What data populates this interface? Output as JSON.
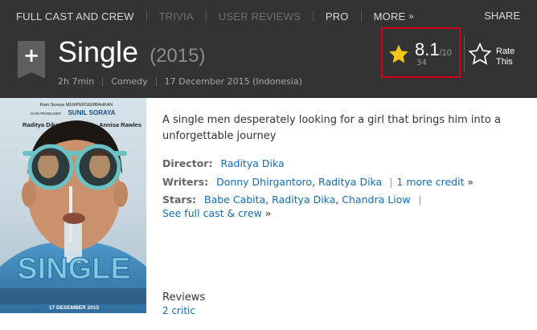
{
  "nav": {
    "full_cast": "FULL CAST AND CREW",
    "trivia": "TRIVIA",
    "user_reviews": "USER REVIEWS",
    "pro": "PRO",
    "more": "MORE",
    "share": "SHARE"
  },
  "movie": {
    "title": "Single",
    "year": "(2015)",
    "runtime": "2h 7min",
    "genre": "Comedy",
    "release": "17 December 2015 (Indonesia)"
  },
  "rating": {
    "value": "8.1",
    "scale": "/10",
    "count": "34",
    "rate_line1": "Rate",
    "rate_line2": "This"
  },
  "poster": {
    "top_credit": "Ram Soraya MEMPERSEMBAHKAN",
    "producer_prefix": "DARI PRODUSER",
    "producer": "SUNIL SORAYA",
    "actor_left": "Raditya Dika",
    "actor_right": "Annisa Rawles",
    "title": "SINGLE",
    "date": "17 DESEMBER 2015"
  },
  "summary": "A single men desperately looking for a girl that brings him into a unforgettable journey",
  "director": {
    "label": "Director:",
    "name": "Raditya Dika"
  },
  "writers": {
    "label": "Writers:",
    "names": [
      "Donny Dhirgantoro",
      "Raditya Dika"
    ],
    "more": "1 more credit",
    "arrow": "»"
  },
  "stars": {
    "label": "Stars:",
    "names": [
      "Babe Cabita",
      "Raditya Dika",
      "Chandra Liow"
    ],
    "full_cast": "See full cast & crew",
    "arrow": "»"
  },
  "reviews": {
    "title": "Reviews",
    "critic": "2 critic"
  },
  "colors": {
    "header_bg": "#333333",
    "link": "#136cb2",
    "star": "#f5c518",
    "highlight": "#d0021b"
  }
}
